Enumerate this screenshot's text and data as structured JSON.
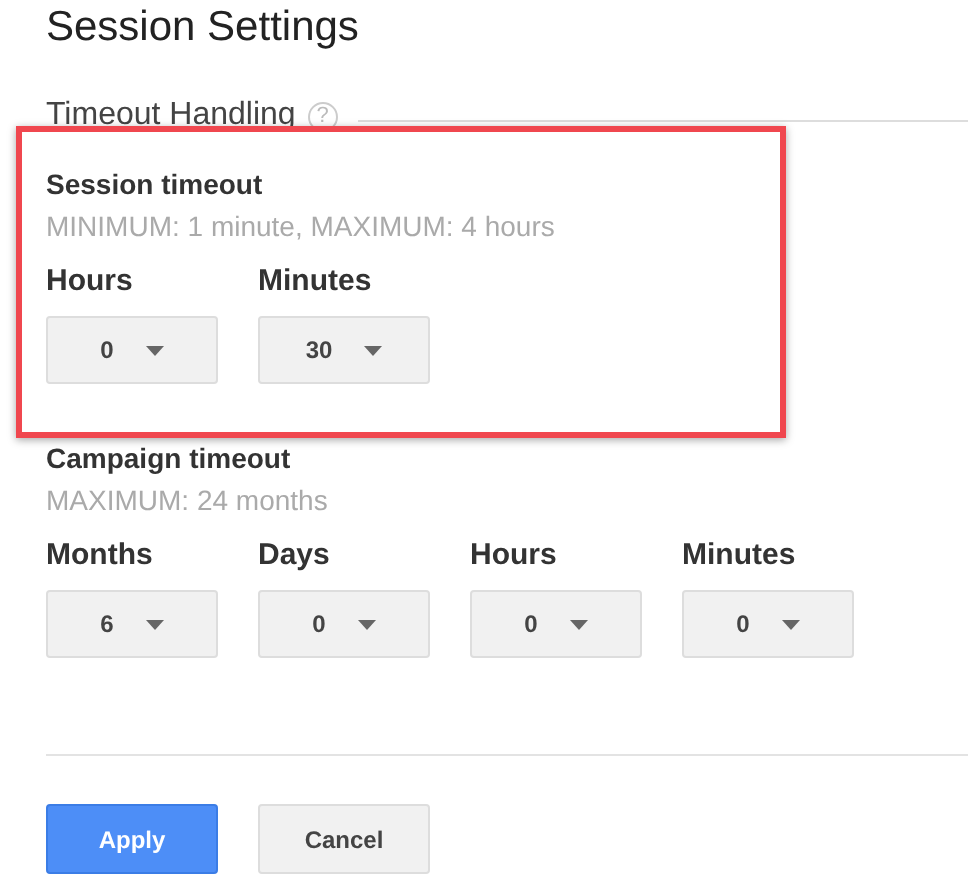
{
  "title": "Session Settings",
  "section": {
    "title": "Timeout Handling",
    "help": "?"
  },
  "groups": [
    {
      "title": "Session timeout",
      "hint": "MINIMUM: 1 minute, MAXIMUM: 4 hours",
      "highlighted": true,
      "fields": [
        {
          "label": "Hours",
          "value": "0"
        },
        {
          "label": "Minutes",
          "value": "30"
        }
      ]
    },
    {
      "title": "Campaign timeout",
      "hint": "MAXIMUM: 24 months",
      "highlighted": false,
      "fields": [
        {
          "label": "Months",
          "value": "6"
        },
        {
          "label": "Days",
          "value": "0"
        },
        {
          "label": "Hours",
          "value": "0"
        },
        {
          "label": "Minutes",
          "value": "0"
        }
      ]
    }
  ],
  "buttons": [
    {
      "label": "Apply",
      "kind": "primary"
    },
    {
      "label": "Cancel",
      "kind": "secondary"
    }
  ]
}
